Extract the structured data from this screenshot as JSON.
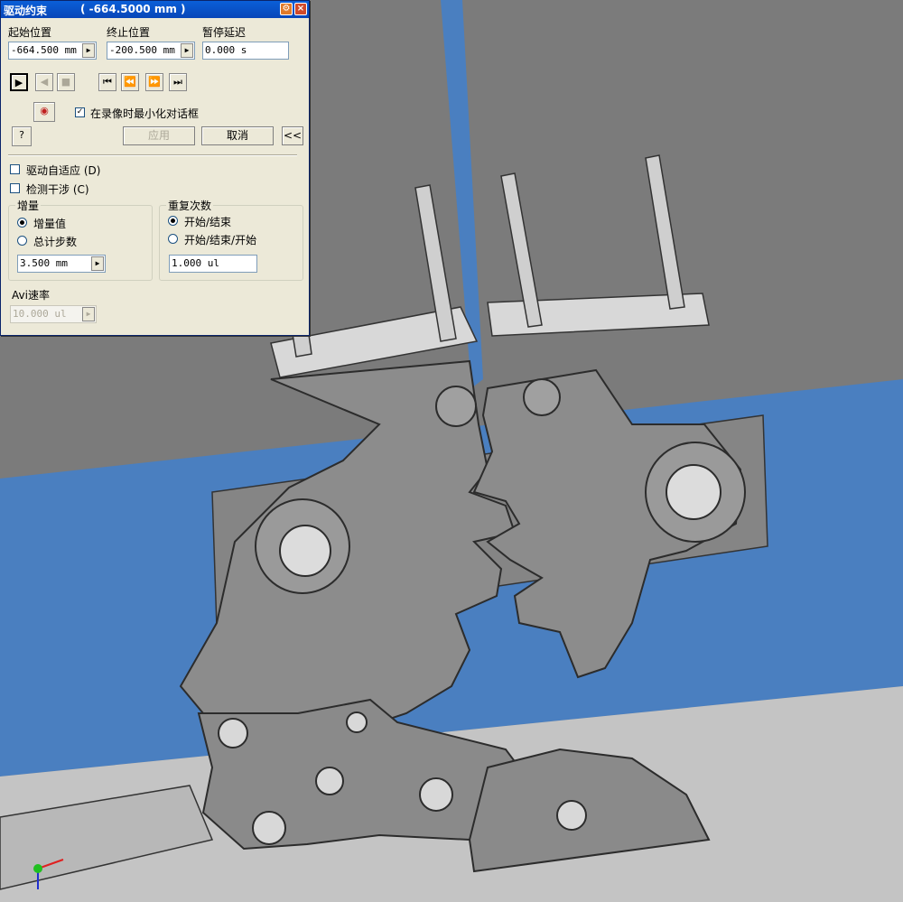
{
  "dialog": {
    "title": "驱动约束",
    "current_value": "( -664.5000 mm )",
    "close_label": "×",
    "help_label": "?",
    "start_position": {
      "label": "起始位置",
      "value": "-664.500 mm"
    },
    "end_position": {
      "label": "终止位置",
      "value": "-200.500 mm"
    },
    "pause_delay": {
      "label": "暂停延迟",
      "value": "0.000 s"
    },
    "minimize_on_record": {
      "label": "在录像时最小化对话框",
      "checked": true
    },
    "apply_label": "应用",
    "cancel_label": "取消",
    "collapse_label": "<<",
    "drive_adaptive": {
      "label": "驱动自适应 (D)",
      "checked": false
    },
    "detect_interference": {
      "label": "检测干涉 (C)",
      "checked": false
    },
    "increment_group": {
      "title": "增量",
      "options": [
        "增量值",
        "总计步数"
      ],
      "selected": "增量值",
      "value": "3.500 mm"
    },
    "repeat_group": {
      "title": "重复次数",
      "options": [
        "开始/结束",
        "开始/结束/开始"
      ],
      "selected": "开始/结束",
      "value": "1.000 ul"
    },
    "avi_rate": {
      "label": "Avi速率",
      "value": "10.000 ul"
    }
  }
}
